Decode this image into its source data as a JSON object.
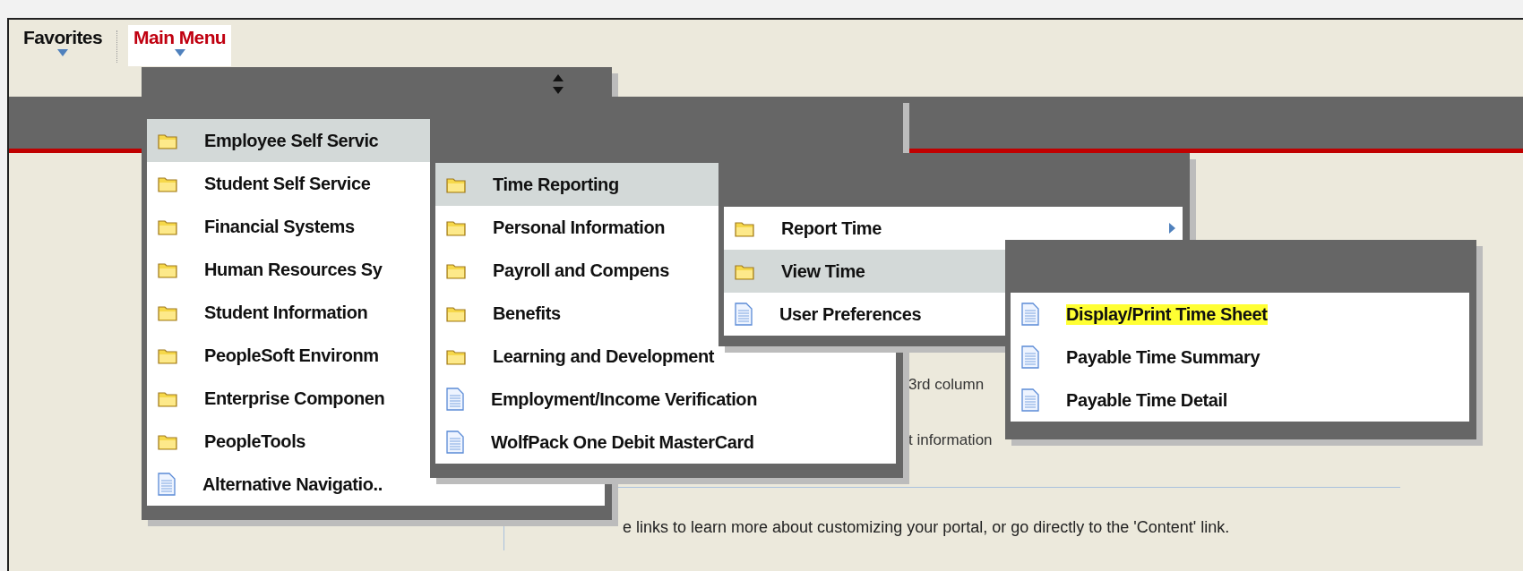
{
  "nav": [
    {
      "label": "Favorites",
      "selected": false
    },
    {
      "label": "Main Menu",
      "selected": true
    }
  ],
  "content": {
    "column_text": [
      "3rd column",
      "t information"
    ],
    "portal_text": "e links to learn more about customizing your portal, or go directly to the 'Content' link."
  },
  "menus": [
    {
      "sort_handle": true,
      "items": [
        {
          "kind": "folder",
          "label": "Employee Self Servic",
          "selected": true,
          "highlighted": false
        },
        {
          "kind": "folder",
          "label": "Student Self Service",
          "selected": false,
          "highlighted": false
        },
        {
          "kind": "folder",
          "label": "Financial Systems",
          "selected": false,
          "highlighted": false
        },
        {
          "kind": "folder",
          "label": "Human Resources Sy",
          "selected": false,
          "highlighted": false
        },
        {
          "kind": "folder",
          "label": "Student Information",
          "selected": false,
          "highlighted": false
        },
        {
          "kind": "folder",
          "label": "PeopleSoft Environm",
          "selected": false,
          "highlighted": false
        },
        {
          "kind": "folder",
          "label": "Enterprise Componen",
          "selected": false,
          "highlighted": false
        },
        {
          "kind": "folder",
          "label": "PeopleTools",
          "selected": false,
          "highlighted": false
        },
        {
          "kind": "page",
          "label": "Alternative Navigatio..",
          "selected": false,
          "highlighted": false
        }
      ]
    },
    {
      "sort_handle": false,
      "items": [
        {
          "kind": "folder",
          "label": "Time Reporting",
          "selected": true,
          "highlighted": false
        },
        {
          "kind": "folder",
          "label": "Personal Information",
          "selected": false,
          "highlighted": false
        },
        {
          "kind": "folder",
          "label": "Payroll and Compens",
          "selected": false,
          "highlighted": false
        },
        {
          "kind": "folder",
          "label": "Benefits",
          "selected": false,
          "highlighted": false
        },
        {
          "kind": "folder",
          "label": "Learning and Development",
          "selected": false,
          "highlighted": false
        },
        {
          "kind": "page",
          "label": "Employment/Income Verification",
          "selected": false,
          "highlighted": false
        },
        {
          "kind": "page",
          "label": "WolfPack One Debit MasterCard",
          "selected": false,
          "highlighted": false
        }
      ]
    },
    {
      "sort_handle": false,
      "items": [
        {
          "kind": "submenu",
          "label": "Report Time",
          "selected": false,
          "highlighted": false
        },
        {
          "kind": "folder",
          "label": "View Time",
          "selected": true,
          "highlighted": false
        },
        {
          "kind": "page",
          "label": "User Preferences",
          "selected": false,
          "highlighted": false
        }
      ]
    },
    {
      "sort_handle": false,
      "items": [
        {
          "kind": "page",
          "label": "Display/Print Time Sheet",
          "selected": false,
          "highlighted": true
        },
        {
          "kind": "page",
          "label": "Payable Time Summary",
          "selected": false,
          "highlighted": false
        },
        {
          "kind": "page",
          "label": "Payable Time Detail",
          "selected": false,
          "highlighted": false
        }
      ]
    }
  ]
}
